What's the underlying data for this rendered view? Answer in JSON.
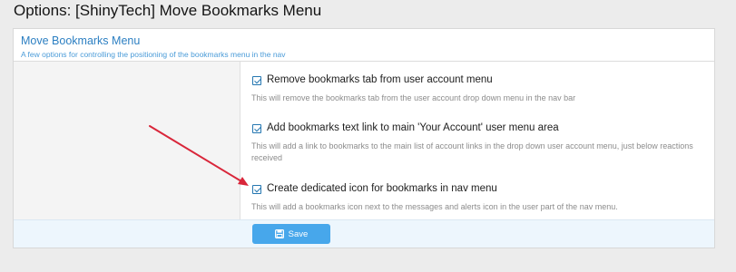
{
  "page": {
    "title": "Options: [ShinyTech] Move Bookmarks Menu"
  },
  "panel": {
    "title": "Move Bookmarks Menu",
    "subtitle": "A few options for controlling the positioning of the bookmarks menu in the nav"
  },
  "options": [
    {
      "label": "Remove bookmarks tab from user account menu",
      "description": "This will remove the bookmarks tab from the user account drop down menu in the nav bar",
      "checked": true
    },
    {
      "label": "Add bookmarks text link to main 'Your Account' user menu area",
      "description": "This will add a link to bookmarks to the main list of account links in the drop down user account menu, just below reactions received",
      "checked": true
    },
    {
      "label": "Create dedicated icon for bookmarks in nav menu",
      "description": "This will add a bookmarks icon next to the messages and alerts icon in the user part of the nav menu.",
      "checked": true
    }
  ],
  "footer": {
    "save_label": "Save",
    "save_icon": "save-icon"
  },
  "colors": {
    "accent": "#47a7eb",
    "link": "#2c7fc2",
    "annotation_arrow": "#d9263a"
  }
}
